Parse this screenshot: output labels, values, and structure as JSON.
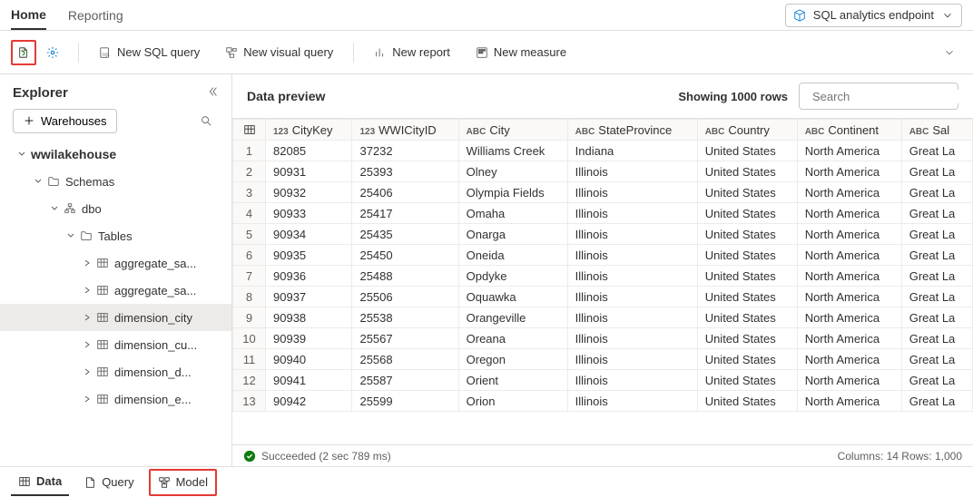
{
  "topTabs": {
    "home": "Home",
    "reporting": "Reporting"
  },
  "endpoint": "SQL analytics endpoint",
  "ribbon": {
    "newSql": "New SQL query",
    "newVisual": "New visual query",
    "newReport": "New report",
    "newMeasure": "New measure"
  },
  "explorer": {
    "title": "Explorer",
    "warehouses": "Warehouses",
    "root": "wwilakehouse",
    "schemas": "Schemas",
    "dbo": "dbo",
    "tables": "Tables",
    "items": [
      "aggregate_sa...",
      "aggregate_sa...",
      "dimension_city",
      "dimension_cu...",
      "dimension_d...",
      "dimension_e..."
    ]
  },
  "preview": {
    "title": "Data preview",
    "showing": "Showing 1000 rows",
    "searchPlaceholder": "Search",
    "columns": [
      {
        "type": "123",
        "name": "CityKey"
      },
      {
        "type": "123",
        "name": "WWICityID"
      },
      {
        "type": "ABC",
        "name": "City"
      },
      {
        "type": "ABC",
        "name": "StateProvince"
      },
      {
        "type": "ABC",
        "name": "Country"
      },
      {
        "type": "ABC",
        "name": "Continent"
      },
      {
        "type": "ABC",
        "name": "Sal"
      }
    ],
    "rows": [
      [
        "82085",
        "37232",
        "Williams Creek",
        "Indiana",
        "United States",
        "North America",
        "Great La"
      ],
      [
        "90931",
        "25393",
        "Olney",
        "Illinois",
        "United States",
        "North America",
        "Great La"
      ],
      [
        "90932",
        "25406",
        "Olympia Fields",
        "Illinois",
        "United States",
        "North America",
        "Great La"
      ],
      [
        "90933",
        "25417",
        "Omaha",
        "Illinois",
        "United States",
        "North America",
        "Great La"
      ],
      [
        "90934",
        "25435",
        "Onarga",
        "Illinois",
        "United States",
        "North America",
        "Great La"
      ],
      [
        "90935",
        "25450",
        "Oneida",
        "Illinois",
        "United States",
        "North America",
        "Great La"
      ],
      [
        "90936",
        "25488",
        "Opdyke",
        "Illinois",
        "United States",
        "North America",
        "Great La"
      ],
      [
        "90937",
        "25506",
        "Oquawka",
        "Illinois",
        "United States",
        "North America",
        "Great La"
      ],
      [
        "90938",
        "25538",
        "Orangeville",
        "Illinois",
        "United States",
        "North America",
        "Great La"
      ],
      [
        "90939",
        "25567",
        "Oreana",
        "Illinois",
        "United States",
        "North America",
        "Great La"
      ],
      [
        "90940",
        "25568",
        "Oregon",
        "Illinois",
        "United States",
        "North America",
        "Great La"
      ],
      [
        "90941",
        "25587",
        "Orient",
        "Illinois",
        "United States",
        "North America",
        "Great La"
      ],
      [
        "90942",
        "25599",
        "Orion",
        "Illinois",
        "United States",
        "North America",
        "Great La"
      ]
    ],
    "status": "Succeeded (2 sec 789 ms)",
    "meta": "Columns: 14  Rows: 1,000"
  },
  "bottom": {
    "data": "Data",
    "query": "Query",
    "model": "Model"
  }
}
